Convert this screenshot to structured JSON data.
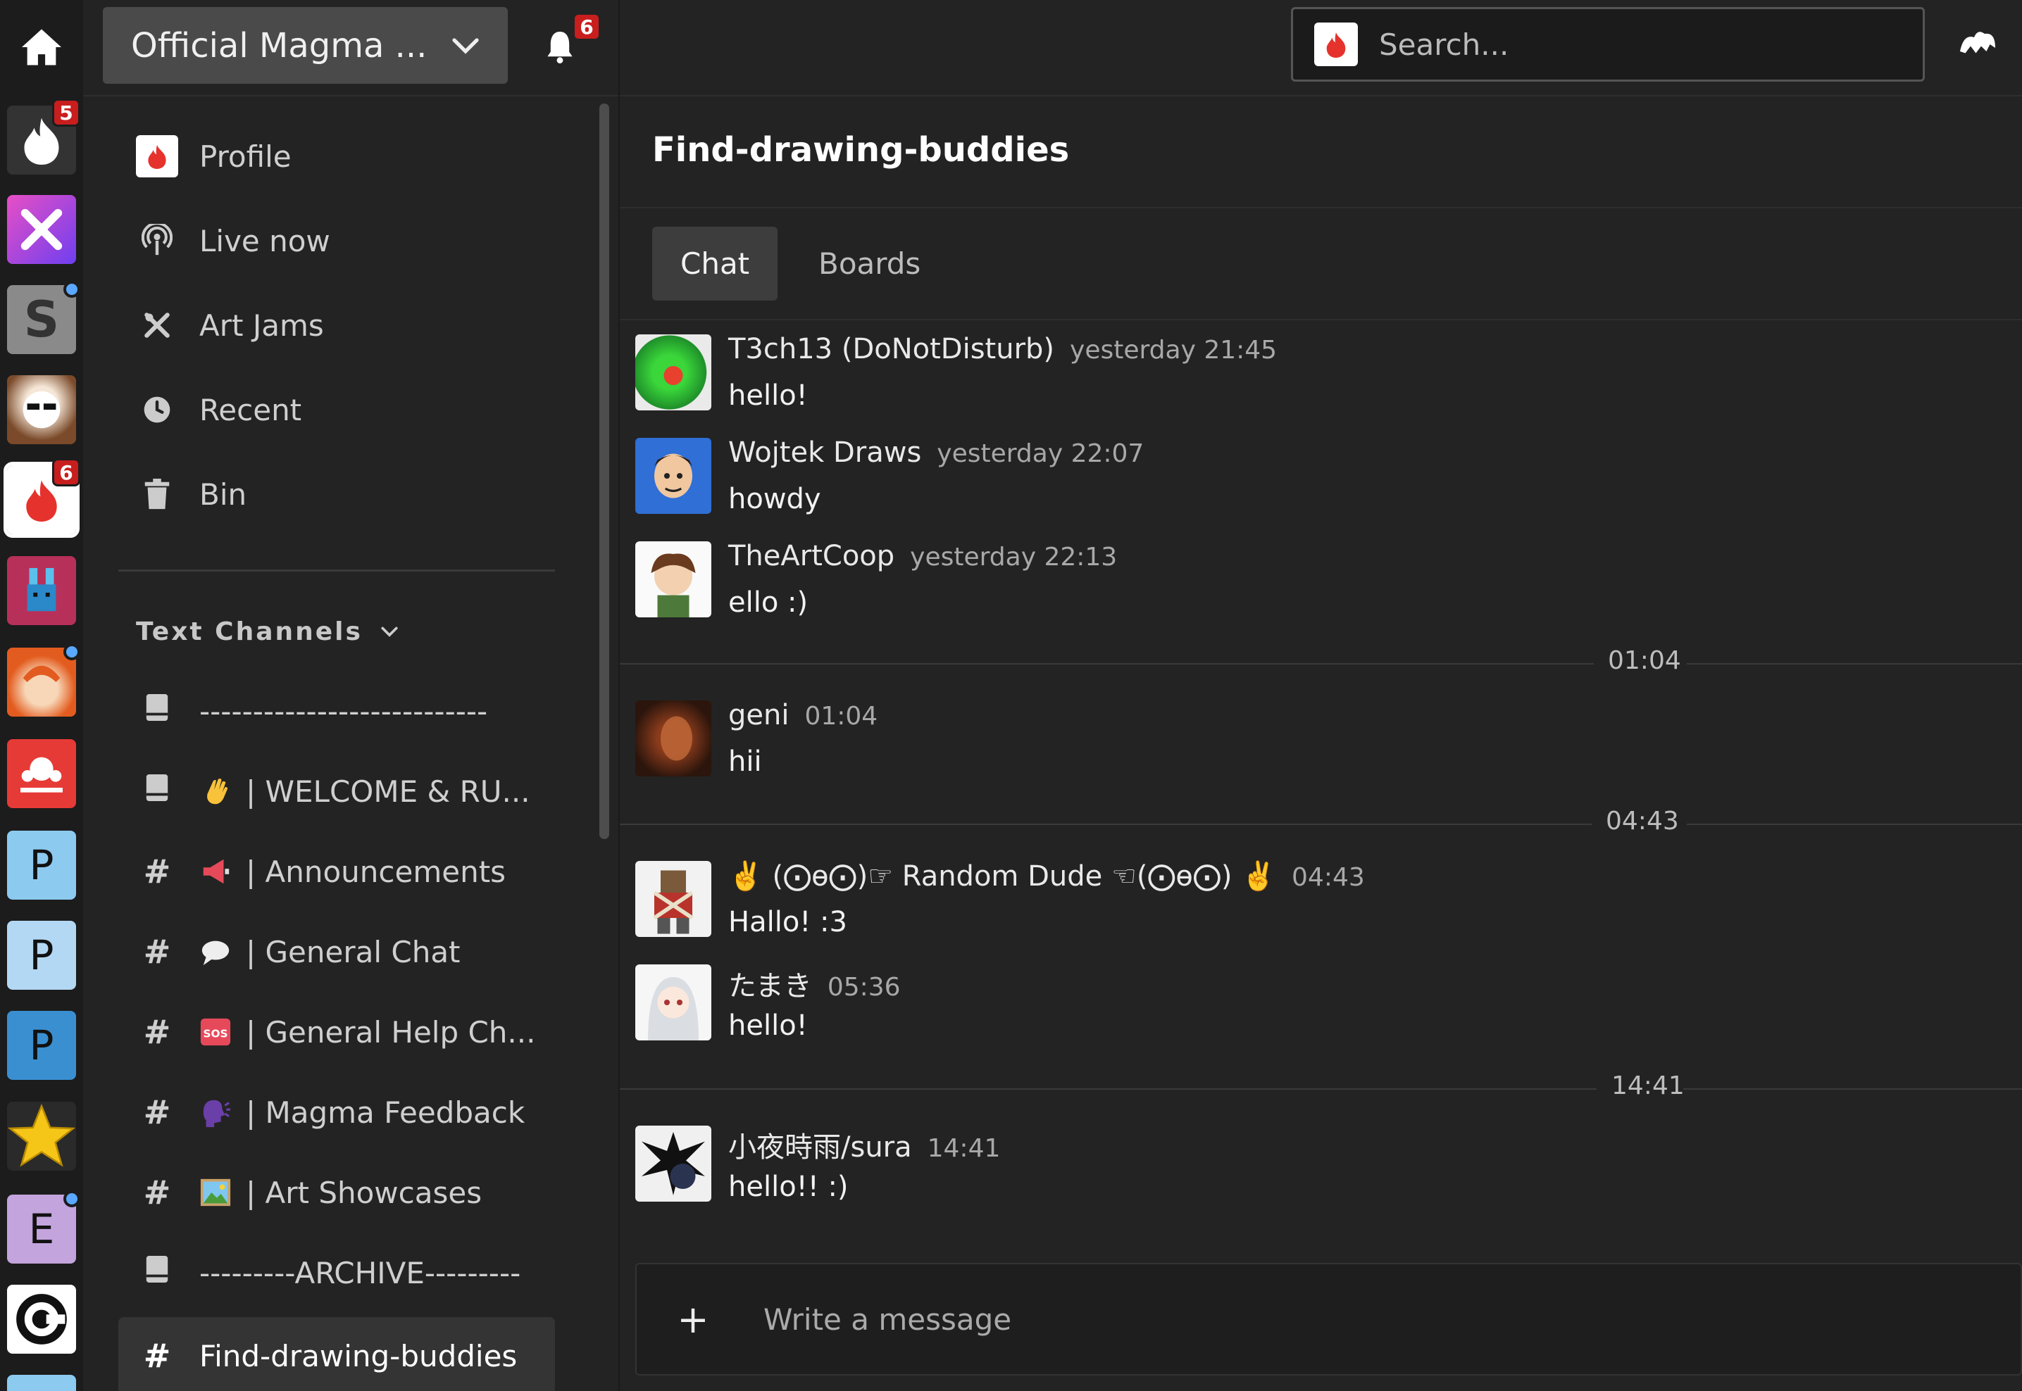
{
  "header": {
    "server_name": "Official Magma ...",
    "notification_count": "6",
    "search_placeholder": "Search..."
  },
  "rail": {
    "badges": {
      "magma_app": "5",
      "official_magma": "6"
    },
    "letters": [
      "P",
      "P",
      "P",
      "E"
    ]
  },
  "sidebar": {
    "nav": [
      {
        "label": "Profile",
        "icon": "magma-logo-icon"
      },
      {
        "label": "Live now",
        "icon": "broadcast-icon"
      },
      {
        "label": "Art Jams",
        "icon": "art-tools-icon"
      },
      {
        "label": "Recent",
        "icon": "clock-icon"
      },
      {
        "label": "Bin",
        "icon": "trash-icon"
      }
    ],
    "text_channels_header": "Text Channels",
    "channels": [
      {
        "label": "---------------------------",
        "kind": "book"
      },
      {
        "label": "| WELCOME & RU...",
        "kind": "book",
        "emoji": "wave"
      },
      {
        "label": "| Announcements",
        "kind": "hash",
        "emoji": "megaphone"
      },
      {
        "label": "| General Chat",
        "kind": "hash",
        "emoji": "speech"
      },
      {
        "label": "| General Help Ch...",
        "kind": "hash",
        "emoji": "sos"
      },
      {
        "label": "| Magma Feedback",
        "kind": "hash",
        "emoji": "speaking-head"
      },
      {
        "label": "| Art Showcases",
        "kind": "hash",
        "emoji": "picture"
      },
      {
        "label": "---------ARCHIVE---------",
        "kind": "book"
      },
      {
        "label": "Find-drawing-buddies",
        "kind": "hash",
        "active": true
      }
    ]
  },
  "main": {
    "channel_title": "Find-drawing-buddies",
    "tabs": [
      {
        "label": "Chat",
        "active": true
      },
      {
        "label": "Boards",
        "active": false
      }
    ],
    "separators": [
      "01:04",
      "04:43",
      "14:41"
    ],
    "messages": [
      {
        "author": "T3ch13 (DoNotDisturb)",
        "time": "yesterday 21:45",
        "text": "hello!"
      },
      {
        "author": "Wojtek Draws",
        "time": "yesterday 22:07",
        "text": "howdy"
      },
      {
        "author": "TheArtCoop",
        "time": "yesterday 22:13",
        "text": "ello :)"
      },
      {
        "author": "geni",
        "time": "01:04",
        "text": "hii"
      },
      {
        "author": "✌️ (⨀ө⨀)☞ Random Dude ☜(⨀ө⨀) ✌️",
        "time": "04:43",
        "text": "Hallo! :3"
      },
      {
        "author": "たまき",
        "time": "05:36",
        "text": "hello!"
      },
      {
        "author": "小夜時雨/sura",
        "time": "14:41",
        "text": "hello!! :)"
      }
    ],
    "composer_placeholder": "Write a message",
    "composer_plus": "+"
  },
  "colors": {
    "background": "#232323",
    "rail": "#1c1c1c",
    "badge": "#c81e1e",
    "brand_red": "#e5322d",
    "online_dot": "#5aa8ff"
  }
}
